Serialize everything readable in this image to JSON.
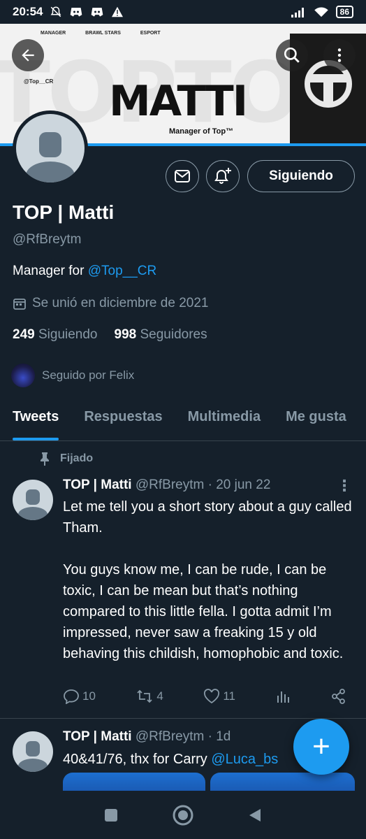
{
  "status_bar": {
    "time": "20:54",
    "battery": "86"
  },
  "banner": {
    "menu_items": [
      "MANAGER",
      "BRAWL STARS",
      "ESPORT"
    ],
    "handle": "@Top__CR",
    "name": "MATTI",
    "subtitle": "Manager of Top™",
    "logo_text": "TOP"
  },
  "profile": {
    "display_name": "TOP | Matti",
    "handle": "@RfBreytm",
    "bio_prefix": "Manager for ",
    "bio_link": "@Top__CR",
    "joined": "Se unió en diciembre de 2021",
    "following_count": "249",
    "following_label": "Siguiendo",
    "followers_count": "998",
    "followers_label": "Seguidores",
    "followed_by": "Seguido por Felix",
    "follow_button": "Siguiendo"
  },
  "tabs": [
    "Tweets",
    "Respuestas",
    "Multimedia",
    "Me gusta"
  ],
  "pinned_label": "Fijado",
  "tweets": [
    {
      "name": "TOP | Matti",
      "handle": "@RfBreytm",
      "date": "· 20 jun 22",
      "text": "Let me tell you a short story about a guy called Tham.\n\nYou guys know me, I can be rude, I can be toxic, I can be mean but that’s nothing compared to this little fella. I gotta admit I’m impressed, never saw a freaking 15 y old behaving this childish, homophobic and toxic.",
      "replies": "10",
      "retweets": "4",
      "likes": "11"
    },
    {
      "name": "TOP | Matti",
      "handle": "@RfBreytm",
      "date": "· 1d",
      "text_prefix": "40&41/76, thx for Carry ",
      "text_link": "@Luca_bs"
    }
  ],
  "fab_label": "+",
  "colors": {
    "accent": "#1d9bf0",
    "background": "#15202b",
    "muted": "#8899a6"
  }
}
